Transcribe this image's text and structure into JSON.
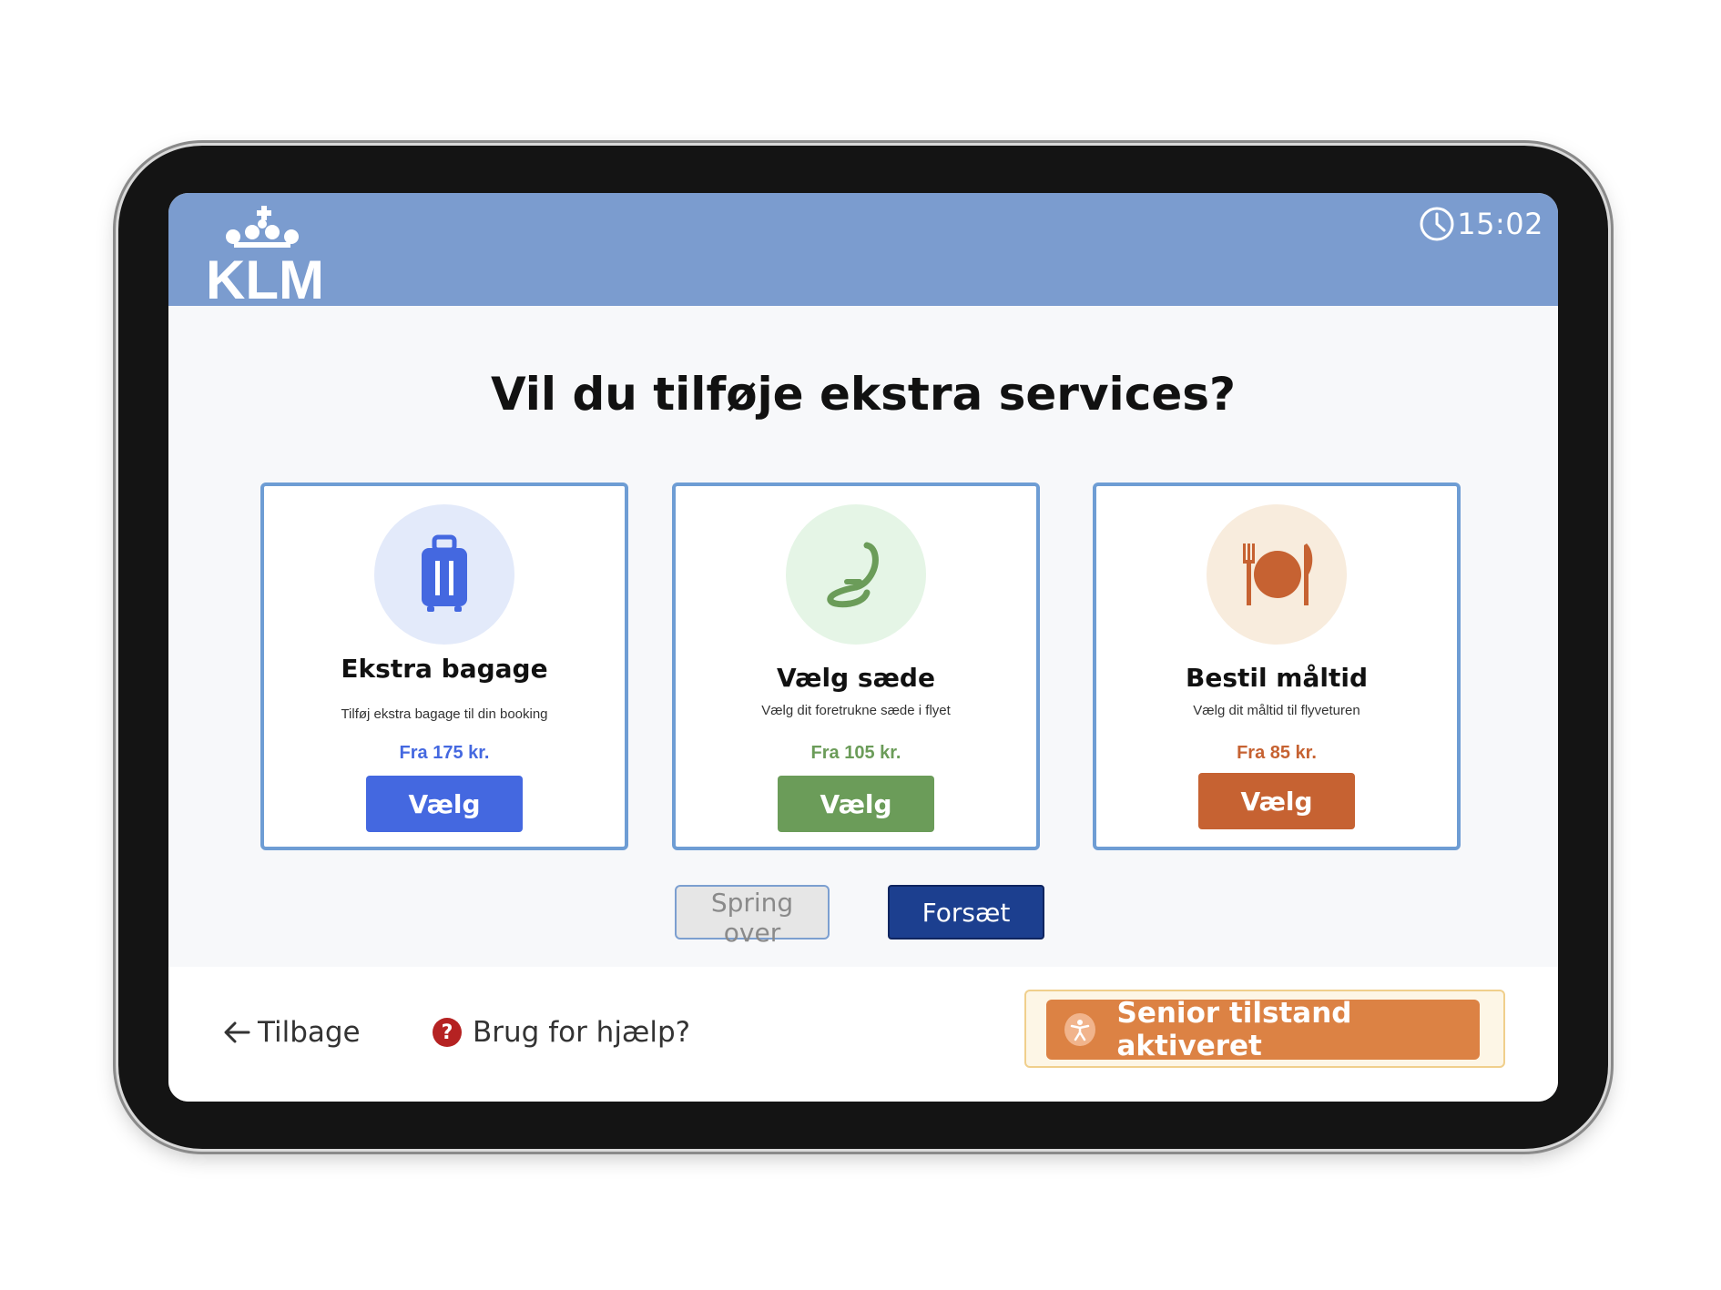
{
  "header": {
    "brand": "KLM",
    "time": "15:02"
  },
  "page": {
    "title": "Vil du tilføje ekstra services?"
  },
  "cards": [
    {
      "icon": "suitcase-icon",
      "title": "Ekstra bagage",
      "subtitle": "Tilføj ekstra bagage til din booking",
      "price": "Fra 175 kr.",
      "button": "Vælg",
      "accent": "#4468e0",
      "icon_bg": "#e3eafa"
    },
    {
      "icon": "seat-icon",
      "title": "Vælg sæde",
      "subtitle": "Vælg dit foretrukne sæde i flyet",
      "price": "Fra 105 kr.",
      "button": "Vælg",
      "accent": "#6b9c59",
      "icon_bg": "#e5f5e6"
    },
    {
      "icon": "meal-icon",
      "title": "Bestil måltid",
      "subtitle": "Vælg dit måltid til flyveturen",
      "price": "Fra 85 kr.",
      "button": "Vælg",
      "accent": "#c66232",
      "icon_bg": "#f8ecdd"
    }
  ],
  "actions": {
    "skip": "Spring over",
    "continue": "Forsæt"
  },
  "footer": {
    "back": "Tilbage",
    "help": "Brug for hjælp?",
    "help_badge": "?",
    "senior_mode": "Senior tilstand aktiveret"
  },
  "colors": {
    "header_bg": "#7b9ccf",
    "card_border": "#6e9dd4",
    "continue_bg": "#1c3f8f",
    "senior_bg": "#dc8244",
    "help_badge": "#b52222"
  }
}
